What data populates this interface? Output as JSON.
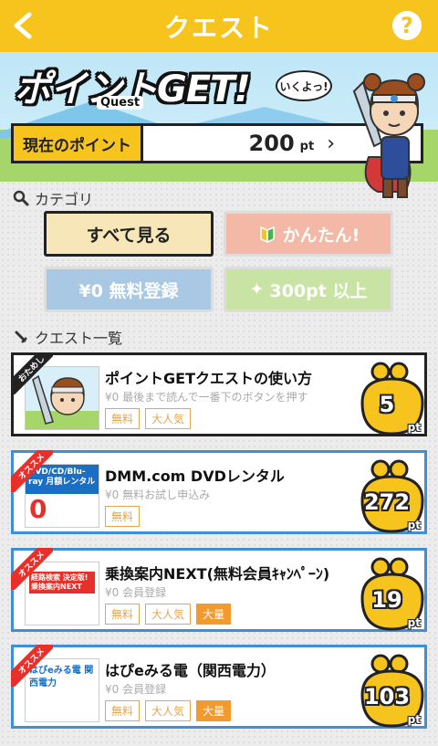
{
  "header": {
    "title": "クエスト",
    "help_label": "?"
  },
  "hero": {
    "logo": "ポイントGET!",
    "logo_sub": "Quest",
    "speech": "いくよっ!",
    "current_points_label": "現在のポイント",
    "current_points_value": "200",
    "current_points_unit": "pt"
  },
  "categories": {
    "title": "カテゴリ",
    "items": [
      {
        "label": "すべて見る",
        "bg": "#f7e7b8"
      },
      {
        "label": "かんたん!",
        "bg": "#f3b8a6"
      },
      {
        "label": "¥0 無料登録",
        "bg": "#a9c8e4"
      },
      {
        "label": "300pt 以上",
        "bg": "#c8e3a3"
      }
    ]
  },
  "quest_list": {
    "title": "クエスト一覧",
    "items": [
      {
        "ribbon": "おためし",
        "title": "ポイントGETクエストの使い方",
        "sub": "¥0 最後まで読んで一番下のボタンを押す",
        "tags": [
          "無料",
          "大人気"
        ],
        "points": "5",
        "unit": "pt"
      },
      {
        "ribbon": "オススメ",
        "thumb_text": "DVD/CD/Blu-ray 月額レンタル",
        "title": "DMM.com DVDレンタル",
        "sub": "¥0 無料お試し申込み",
        "tags": [
          "無料"
        ],
        "points": "272",
        "unit": "pt"
      },
      {
        "ribbon": "オススメ",
        "thumb_text": "経路検索 決定版! 乗換案内NEXT",
        "title": "乗換案内NEXT(無料会員ｷｬﾝﾍﾟｰﾝ)",
        "sub": "¥0 会員登録",
        "tags": [
          "無料",
          "大人気",
          "大量"
        ],
        "points": "19",
        "unit": "pt"
      },
      {
        "ribbon": "オススメ",
        "thumb_text": "はぴeみる電 関西電力",
        "title": "はぴeみる電（関西電力）",
        "sub": "¥0 会員登録",
        "tags": [
          "無料",
          "大人気",
          "大量"
        ],
        "points": "103",
        "unit": "pt"
      }
    ]
  }
}
